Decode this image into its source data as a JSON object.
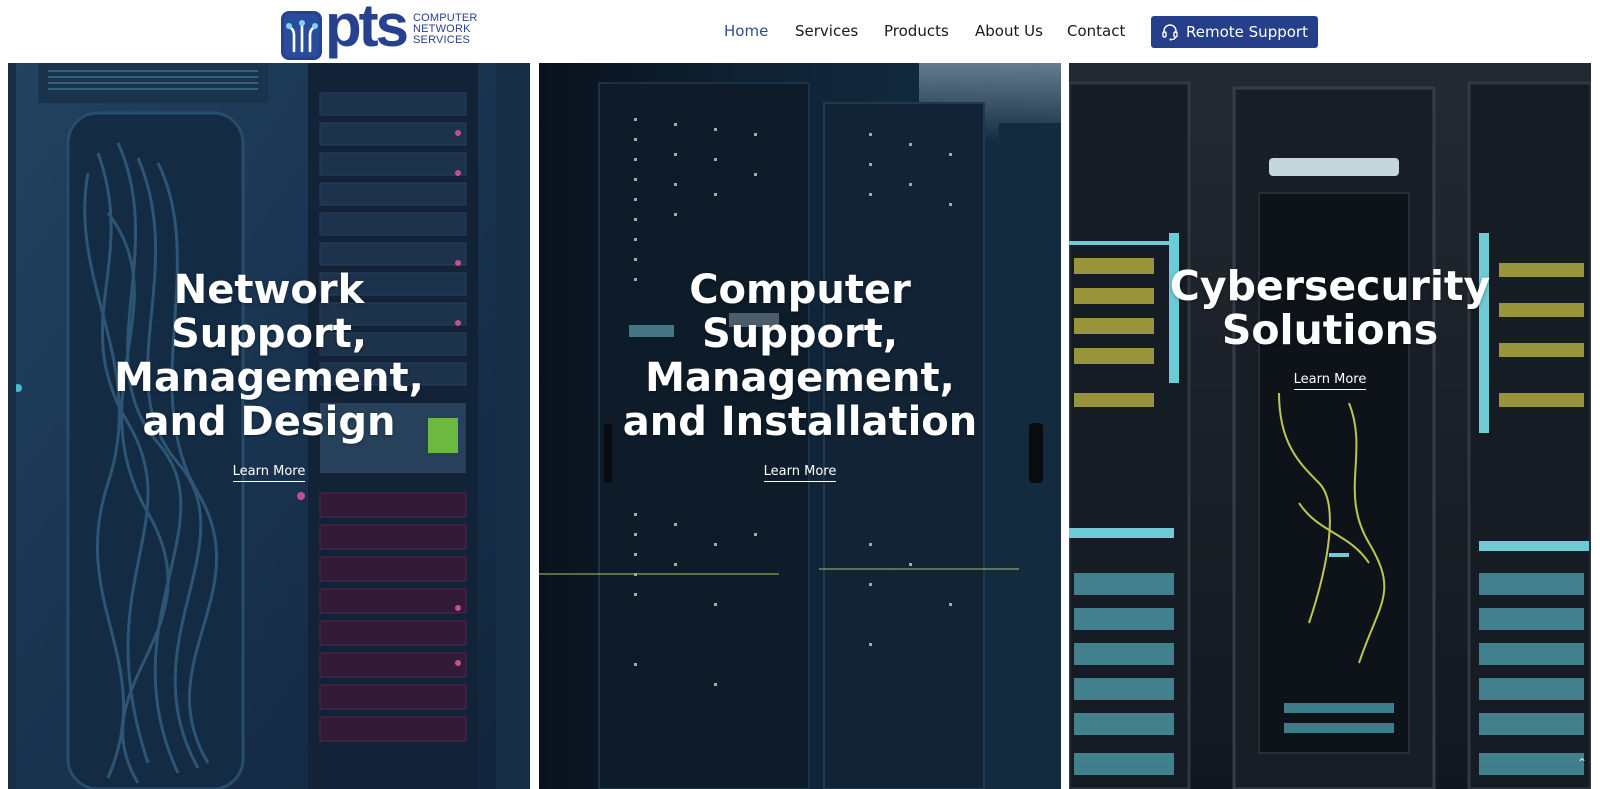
{
  "brand": {
    "logo_word": "pts",
    "logo_sub": [
      "COMPUTER",
      "NETWORK",
      "SERVICES"
    ],
    "color": "#27418f"
  },
  "nav": {
    "items": [
      {
        "label": "Home",
        "active": true
      },
      {
        "label": "Services",
        "active": false
      },
      {
        "label": "Products",
        "active": false
      },
      {
        "label": "About Us",
        "active": false
      },
      {
        "label": "Contact",
        "active": false
      }
    ],
    "cta": {
      "label": "Remote Support",
      "icon": "headset-icon",
      "color": "#253f8a"
    }
  },
  "panels": [
    {
      "title": "Network Support, Management, and Design",
      "link": "Learn More"
    },
    {
      "title": "Computer Support, Management, and Installation",
      "link": "Learn More"
    },
    {
      "title": "Cybersecurity Solutions",
      "link": "Learn More"
    }
  ],
  "scroll_top": {
    "icon": "chevron-up-icon",
    "glyph": "⌃"
  }
}
